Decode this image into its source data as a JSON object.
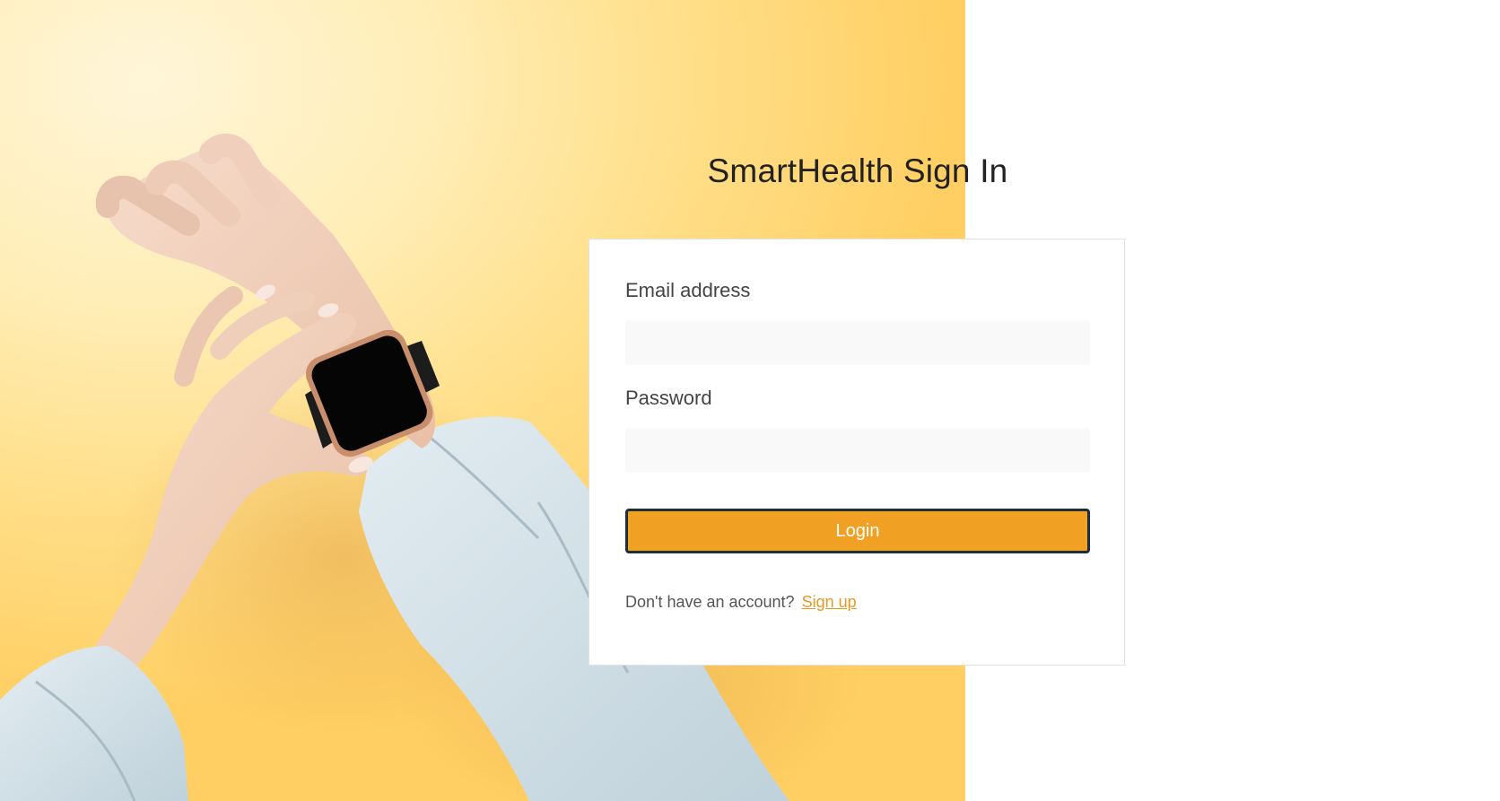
{
  "page": {
    "title": "SmartHealth Sign In"
  },
  "hero_image": {
    "icon": "hands-smartwatch-image"
  },
  "form": {
    "email_label": "Email address",
    "email_value": "",
    "email_placeholder": "",
    "password_label": "Password",
    "password_value": "",
    "password_placeholder": "",
    "login_label": "Login",
    "signup_prompt": "Don't have an account?",
    "signup_link": "Sign up"
  },
  "colors": {
    "accent": "#f0a022",
    "button_border": "#1e2f3a",
    "link": "#e89a24",
    "hero_background": "#ffd97a"
  }
}
